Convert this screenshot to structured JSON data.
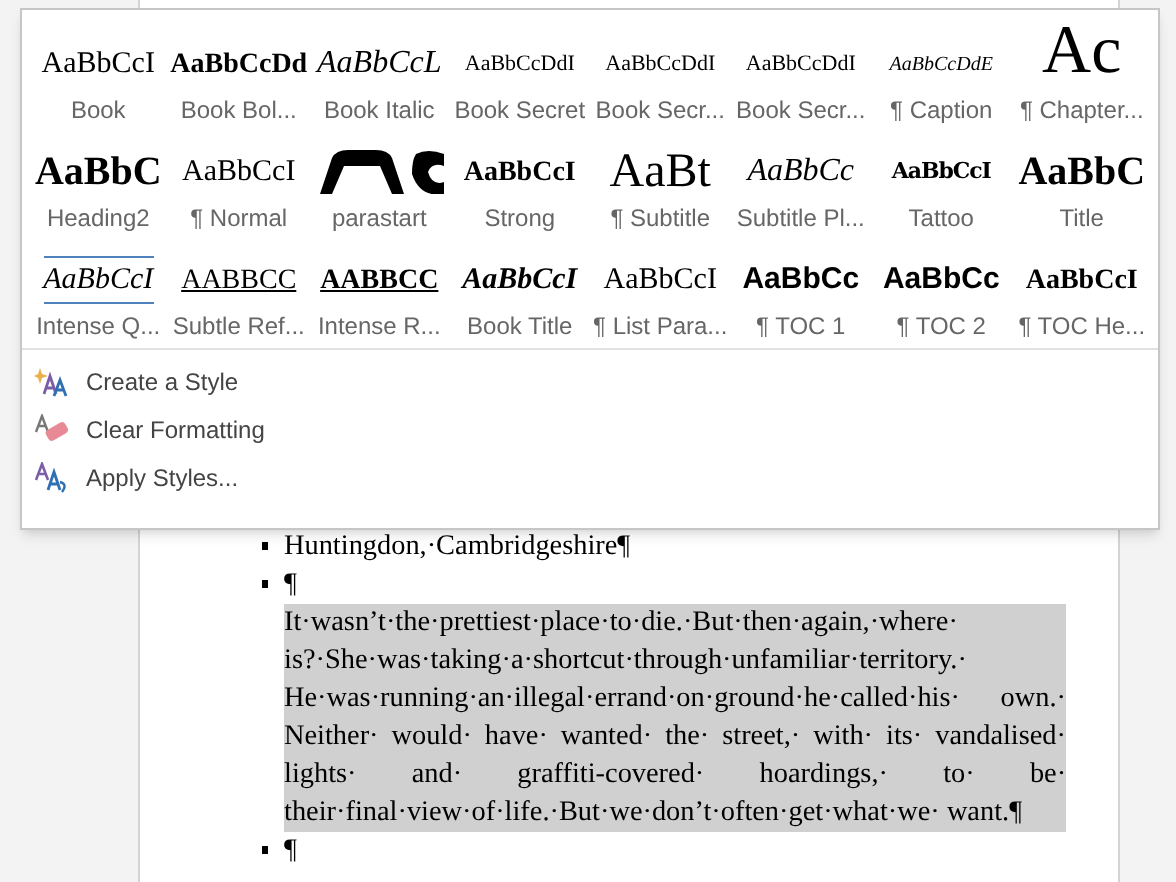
{
  "styles_gallery": [
    {
      "preview": "AaBbCcI",
      "label": "Book",
      "kind": "serif"
    },
    {
      "preview": "AaBbCcDd",
      "label": "Book Bol...",
      "kind": "serif-bold"
    },
    {
      "preview": "AaBbCcL",
      "label": "Book Italic",
      "kind": "serif-italic"
    },
    {
      "preview": "AaBbCcDdI",
      "label": "Book Secret",
      "kind": "small"
    },
    {
      "preview": "AaBbCcDdI",
      "label": "Book Secr...",
      "kind": "small"
    },
    {
      "preview": "AaBbCcDdI",
      "label": "Book Secr...",
      "kind": "small"
    },
    {
      "preview": "AaBbCcDdE",
      "label": "¶ Caption",
      "kind": "small-italic"
    },
    {
      "preview": "Ac",
      "label": "¶ Chapter...",
      "kind": "huge"
    },
    {
      "preview": "AaBbC",
      "label": "Heading2",
      "kind": "heading"
    },
    {
      "preview": "AaBbCcI",
      "label": "¶ Normal",
      "kind": "serif"
    },
    {
      "label": "parastart",
      "kind": "drawing"
    },
    {
      "preview": "AaBbCcI",
      "label": "Strong",
      "kind": "serif-bold"
    },
    {
      "preview": "AaBt",
      "label": "¶ Subtitle",
      "kind": "large"
    },
    {
      "preview": "AaBbCc",
      "label": "Subtitle Pl...",
      "kind": "serif-italic"
    },
    {
      "preview": "AaBbCcI",
      "label": "Tattoo",
      "kind": "fancy"
    },
    {
      "preview": "AaBbC",
      "label": "Title",
      "kind": "heading"
    },
    {
      "preview": "AaBbCcI",
      "label": "Intense Q...",
      "kind": "quote"
    },
    {
      "preview": "AABBCC",
      "label": "Subtle Ref...",
      "kind": "ref"
    },
    {
      "preview": "AABBCC",
      "label": "Intense R...",
      "kind": "ref-bold"
    },
    {
      "preview": "AaBbCcI",
      "label": "Book Title",
      "kind": "bold-italic"
    },
    {
      "preview": "AaBbCcI",
      "label": "¶ List Para...",
      "kind": "serif"
    },
    {
      "preview": "AaBbCc",
      "label": "¶ TOC 1",
      "kind": "sans-bold"
    },
    {
      "preview": "AaBbCc",
      "label": "¶ TOC 2",
      "kind": "sans-bold"
    },
    {
      "preview": "AaBbCcI",
      "label": "¶ TOC He...",
      "kind": "serif-bold"
    }
  ],
  "menu": [
    {
      "label": "Create a Style",
      "kind": "create"
    },
    {
      "label": "Clear Formatting",
      "kind": "clear"
    },
    {
      "label": "Apply Styles...",
      "kind": "apply"
    }
  ],
  "document": [
    {
      "text": "Huntingdon,·Cambridgeshire¶",
      "bullet": true,
      "selected": false
    },
    {
      "text": "¶",
      "bullet": true,
      "selected": false
    },
    {
      "text": "It·wasn’t·the·prettiest·place·to·die.·But·then·again,·where· is?·She·was·taking·a·shortcut·through·unfamiliar·territory.· He·was·running·an·illegal·errand·on·ground·he·called·his· own.· Neither· would· have· wanted· the· street,· with· its· vandalised· lights· and· graffiti-covered· hoardings,· to· be· their·final·view·of·life.·But·we·don’t·often·get·what·we· want.¶",
      "bullet": false,
      "selected": true
    },
    {
      "text": "¶",
      "bullet": true,
      "selected": false
    }
  ]
}
